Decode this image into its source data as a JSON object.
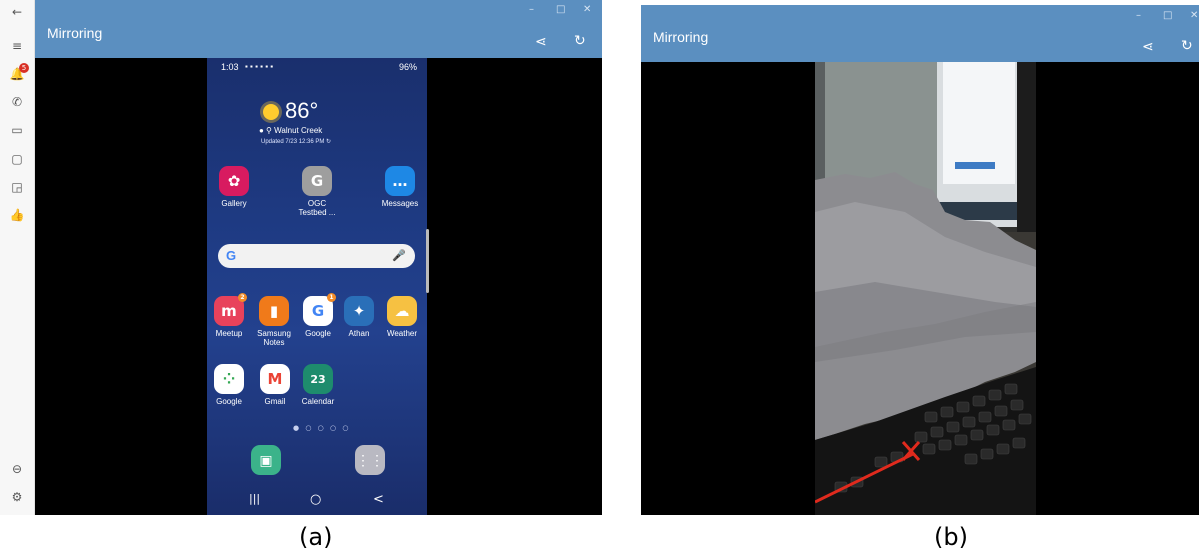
{
  "panel_a": {
    "app_title": "Mirroring",
    "notification_count": "5",
    "nav_icons": [
      "back-icon",
      "menu-icon",
      "notifications-icon",
      "phone-icon",
      "messages-icon",
      "files-icon",
      "cast-icon",
      "thumbs-up-icon",
      "minus-circle-icon",
      "settings-icon"
    ],
    "header_icons": [
      "share-icon",
      "refresh-icon"
    ],
    "phone": {
      "status_time": "1:03",
      "battery": "96%",
      "weather": {
        "temp": "86°",
        "location": "Walnut Creek",
        "updated": "Updated 7/23 12:36 PM"
      },
      "apps_row1": [
        {
          "label": "Gallery",
          "color": "#d81b60",
          "glyph": "✿"
        },
        {
          "label": "OGC Testbed ...",
          "color": "#9e9e9e",
          "glyph": "G"
        },
        {
          "label": "Messages",
          "color": "#1e88e5",
          "glyph": "…"
        }
      ],
      "apps_row2": [
        {
          "label": "Meetup",
          "color": "#e8425b",
          "glyph": "m",
          "badge": "2"
        },
        {
          "label": "Samsung Notes",
          "color": "#f07a1a",
          "glyph": "▮"
        },
        {
          "label": "Google",
          "color": "#ffffff",
          "glyph": "G",
          "badge": "1"
        },
        {
          "label": "Athan",
          "color": "#2a6fb8",
          "glyph": "✦"
        },
        {
          "label": "Weather",
          "color": "#f6c142",
          "glyph": "☁"
        }
      ],
      "apps_row3": [
        {
          "label": "Google",
          "color": "#ffffff",
          "glyph": "⁘"
        },
        {
          "label": "Gmail",
          "color": "#ffffff",
          "glyph": "M"
        },
        {
          "label": "Calendar",
          "color": "#1e8c6d",
          "glyph": "23"
        }
      ],
      "search_logo": "G",
      "pager": "● ○ ○ ○ ○",
      "nav_buttons": [
        "|||",
        "○",
        "<"
      ]
    },
    "caption": "(a)"
  },
  "panel_b": {
    "app_title": "Mirroring",
    "header_icons": [
      "share-icon",
      "refresh-icon"
    ],
    "caption": "(b)"
  },
  "colors": {
    "titlebar": "#5b8fc0",
    "accent_red": "#e02a1d"
  }
}
